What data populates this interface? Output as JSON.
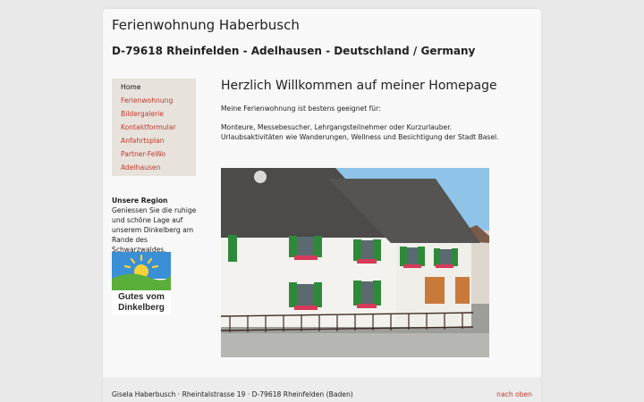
{
  "header": {
    "title": "Ferienwohnung Haberbusch",
    "subtitle": "D-79618 Rheinfelden - Adelhausen - Deutschland / Germany"
  },
  "nav": {
    "items": [
      {
        "label": "Home",
        "active": true
      },
      {
        "label": "Ferienwohnung",
        "active": false
      },
      {
        "label": "Bildergalerie",
        "active": false
      },
      {
        "label": "Kontaktformular",
        "active": false
      },
      {
        "label": "Anfahrtsplan",
        "active": false
      },
      {
        "label": "Partner-FeWo",
        "active": false
      },
      {
        "label": "Adelhausen",
        "active": false
      }
    ]
  },
  "sidebar": {
    "region_title": "Unsere Region",
    "region_text": "Geniessen Sie die ruhige und schöne Lage auf unserem Dinkelberg am Rande des Schwarzwaldes.",
    "logo": {
      "line1": "Gutes vom",
      "line2": "Dinkelberg"
    }
  },
  "main": {
    "heading": "Herzlich Willkommen auf meiner Homepage",
    "intro": "Meine Ferienwohnung ist bestens geeignet für:",
    "audience": "Monteure, Messebesucher, Lehrgangsteilnehmer oder Kurzurlauber.",
    "activities": "Urlaubsaktivitäten wie Wanderungen, Wellness und Besichtigung der Stadt Basel."
  },
  "footer": {
    "address": "Gisela Haberbusch · Rheintalstrasse 19 · D-79618 Rheinfelden (Baden)",
    "back_to_top": "nach oben"
  },
  "colors": {
    "link": "#c0392b",
    "nav_background": "#e7e2dc",
    "page_background": "#e9e9e9"
  }
}
